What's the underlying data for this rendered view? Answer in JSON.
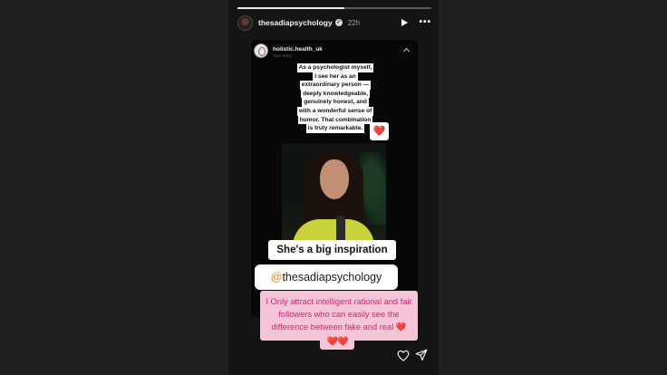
{
  "header": {
    "username": "thesadiapsychology",
    "verified": "✓",
    "time": "22h",
    "progress_fraction": 0.55
  },
  "reshared": {
    "username": "holistic.health_uk",
    "subtitle": "Your Story",
    "quote_lines": [
      "As a psychologist myself,",
      "I see her as an",
      "extraordinary person —",
      "deeply knowledgeable,",
      "genuinely honest, and",
      "with a wonderful sense of",
      "humor. That combination",
      "is truly remarkable."
    ],
    "heart_sticker": "❤️"
  },
  "inspiration_caption": "She's a big inspiration",
  "mention": {
    "at": "@",
    "handle": "thesadiapsychology"
  },
  "overlay_text": "I Only attract intelligent rational and fair followers who can easily see the difference between fake and real ❤️",
  "overlay_hearts": "❤️❤️",
  "icons": {
    "play": "play-icon",
    "more": "more-options-icon",
    "like": "heart-outline-icon",
    "share": "send-icon"
  },
  "colors": {
    "background": "#1f1f1f",
    "overlay_bg": "#f6c4d8",
    "overlay_text": "#d81f78",
    "mention_at": "#f08a1c"
  }
}
